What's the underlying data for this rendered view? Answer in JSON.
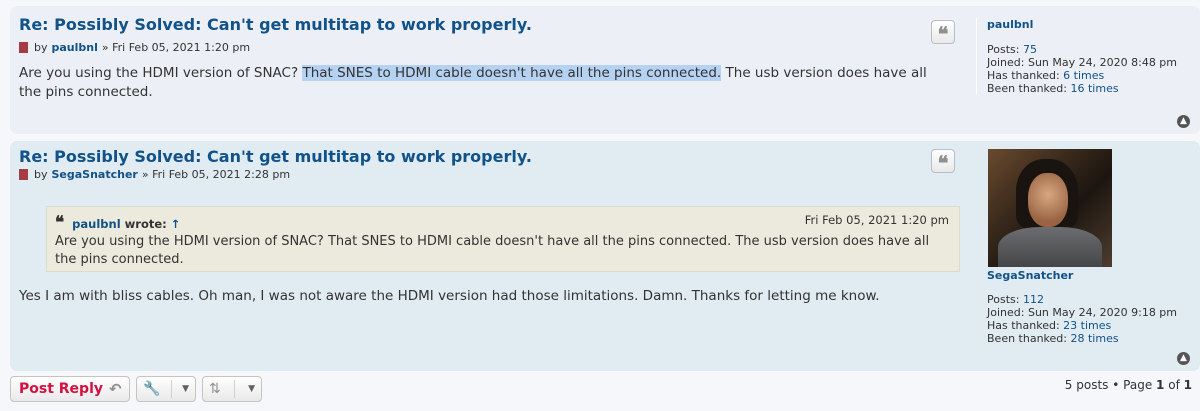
{
  "posts": [
    {
      "title": "Re: Possibly Solved: Can't get multitap to work properly.",
      "by": "by",
      "author": "paulbnl",
      "date": "» Fri Feb 05, 2021 1:20 pm",
      "content_pre": "Are you using the HDMI version of SNAC? ",
      "content_highlight": "That SNES to HDMI cable doesn't have all the pins connected.",
      "content_post": " The usb version does have all the pins connected.",
      "profile": {
        "name": "paulbnl",
        "posts_label": "Posts:",
        "posts": "75",
        "joined_label": "Joined:",
        "joined": "Sun May 24, 2020 8:48 pm",
        "thanked_label": "Has thanked:",
        "thanked": "6 times",
        "been_thanked_label": "Been thanked:",
        "been_thanked": "16 times"
      }
    },
    {
      "title": "Re: Possibly Solved: Can't get multitap to work properly.",
      "by": "by",
      "author": "SegaSnatcher",
      "date": "» Fri Feb 05, 2021 2:28 pm",
      "quote": {
        "author": "paulbnl",
        "wrote": "wrote:",
        "arrow": "↑",
        "date": "Fri Feb 05, 2021 1:20 pm",
        "text": "Are you using the HDMI version of SNAC? That SNES to HDMI cable doesn't have all the pins connected. The usb version does have all the pins connected."
      },
      "content": "Yes I am with bliss cables. Oh man, I was not aware the HDMI version had those limitations. Damn. Thanks for letting me know.",
      "profile": {
        "name": "SegaSnatcher",
        "posts_label": "Posts:",
        "posts": "112",
        "joined_label": "Joined:",
        "joined": "Sun May 24, 2020 9:18 pm",
        "thanked_label": "Has thanked:",
        "thanked": "23 times",
        "been_thanked_label": "Been thanked:",
        "been_thanked": "28 times"
      }
    }
  ],
  "actions": {
    "post_reply": "Post Reply",
    "reply_icon": "reply-arrow-icon",
    "tools_icon": "wrench-icon",
    "sort_icon": "sort-icon"
  },
  "pagination": {
    "posts_count": "5 posts",
    "bullet": "•",
    "page_label": "Page",
    "current": "1",
    "of": "of",
    "total": "1"
  },
  "colors": {
    "link": "#105289",
    "post_reply": "#d31141",
    "post_bg1": "#ecf0f6",
    "post_bg2": "#e1ebf2",
    "quote_bg": "#ebeadd",
    "highlight": "#b6d2f2"
  }
}
